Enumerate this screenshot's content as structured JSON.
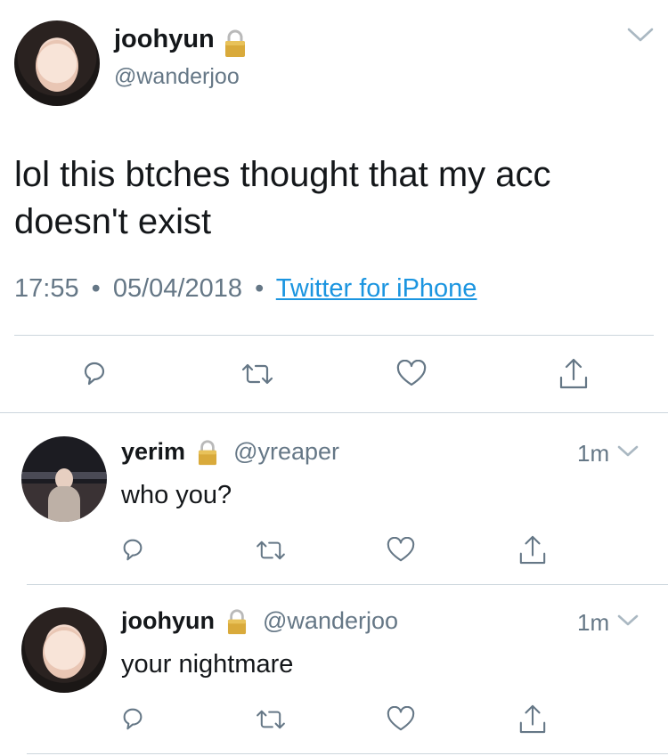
{
  "main_tweet": {
    "display_name": "joohyun",
    "handle": "@wanderjoo",
    "text_line1": "lol this btches thought that my acc",
    "text_line2": "doesn't exist",
    "time": "17:55",
    "date": "05/04/2018",
    "separator": "•",
    "source": "Twitter for iPhone"
  },
  "replies": [
    {
      "display_name": "yerim",
      "handle": "@yreaper",
      "time_ago": "1m",
      "text": "who you?"
    },
    {
      "display_name": "joohyun",
      "handle": "@wanderjoo",
      "time_ago": "1m",
      "text": "your nightmare"
    }
  ],
  "icons": [
    "lock-icon",
    "chevron-down-icon",
    "reply-icon",
    "retweet-icon",
    "like-icon",
    "share-icon"
  ],
  "colors": {
    "text": "#14171a",
    "secondary": "#657786",
    "link": "#1b95e0",
    "divider": "#ccd6dd",
    "chevron": "#aab8c2"
  }
}
